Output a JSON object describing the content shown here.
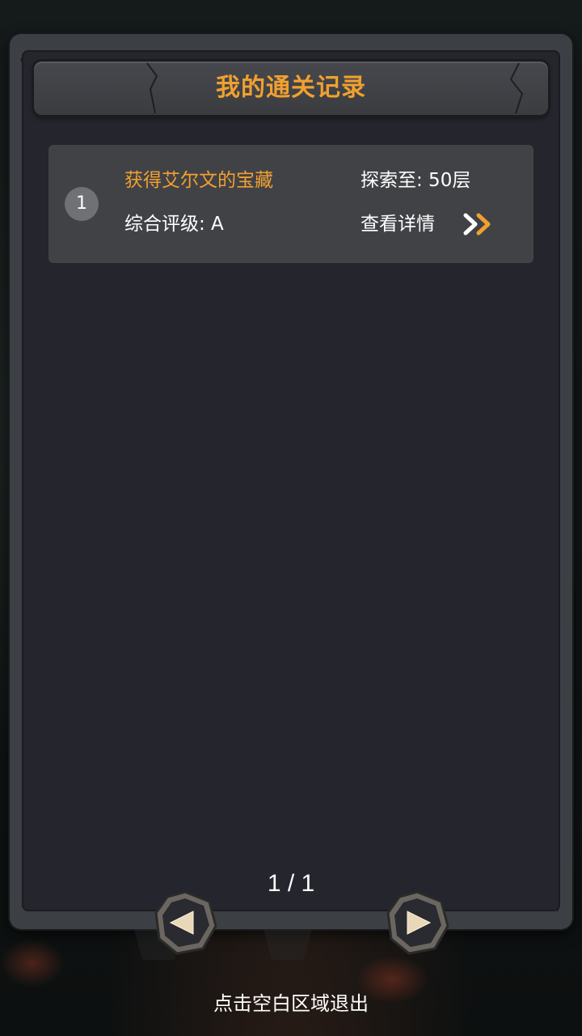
{
  "panel": {
    "title": "我的通关记录"
  },
  "records": [
    {
      "rank": "1",
      "title": "获得艾尔文的宝藏",
      "explored": "探索至: 50层",
      "rating": "综合评级: A",
      "detail_label": "查看详情",
      "detail_icon": "double-chevron-right-icon"
    }
  ],
  "pagination": {
    "indicator": "1 / 1",
    "prev_icon": "triangle-left-icon",
    "next_icon": "triangle-right-icon"
  },
  "footer": {
    "exit_hint": "点击空白区域退出"
  },
  "colors": {
    "accent": "#f0a030",
    "panel_bg": "#24252d",
    "card_bg": "#414246",
    "frame": "#3c3f44"
  }
}
